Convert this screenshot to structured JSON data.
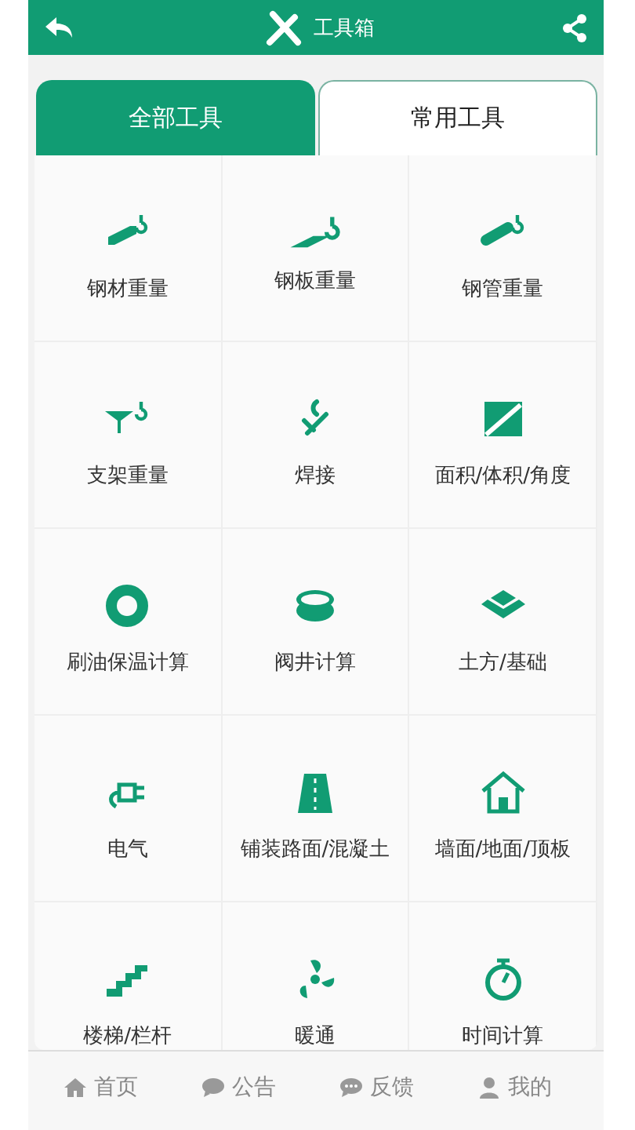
{
  "header": {
    "title": "工具箱"
  },
  "tabs": [
    {
      "label": "全部工具",
      "selected": true
    },
    {
      "label": "常用工具",
      "selected": false
    }
  ],
  "tools": [
    {
      "kind": "steel-bar",
      "label": "钢材重量"
    },
    {
      "kind": "steel-plate",
      "label": "钢板重量"
    },
    {
      "kind": "steel-pipe",
      "label": "钢管重量"
    },
    {
      "kind": "support",
      "label": "支架重量"
    },
    {
      "kind": "welding",
      "label": "焊接"
    },
    {
      "kind": "area",
      "label": "面积/体积/角度"
    },
    {
      "kind": "coating",
      "label": "刷油保温计算"
    },
    {
      "kind": "well",
      "label": "阀井计算"
    },
    {
      "kind": "earth",
      "label": "土方/基础"
    },
    {
      "kind": "electric",
      "label": "电气"
    },
    {
      "kind": "road",
      "label": "铺装路面/混凝土"
    },
    {
      "kind": "house",
      "label": "墙面/地面/顶板"
    },
    {
      "kind": "stairs",
      "label": "楼梯/栏杆"
    },
    {
      "kind": "fan",
      "label": "暖通"
    },
    {
      "kind": "timer",
      "label": "时间计算"
    }
  ],
  "nav": [
    {
      "kind": "home",
      "label": "首页"
    },
    {
      "kind": "chat",
      "label": "公告"
    },
    {
      "kind": "feedback",
      "label": "反馈"
    },
    {
      "kind": "user",
      "label": "我的"
    }
  ]
}
